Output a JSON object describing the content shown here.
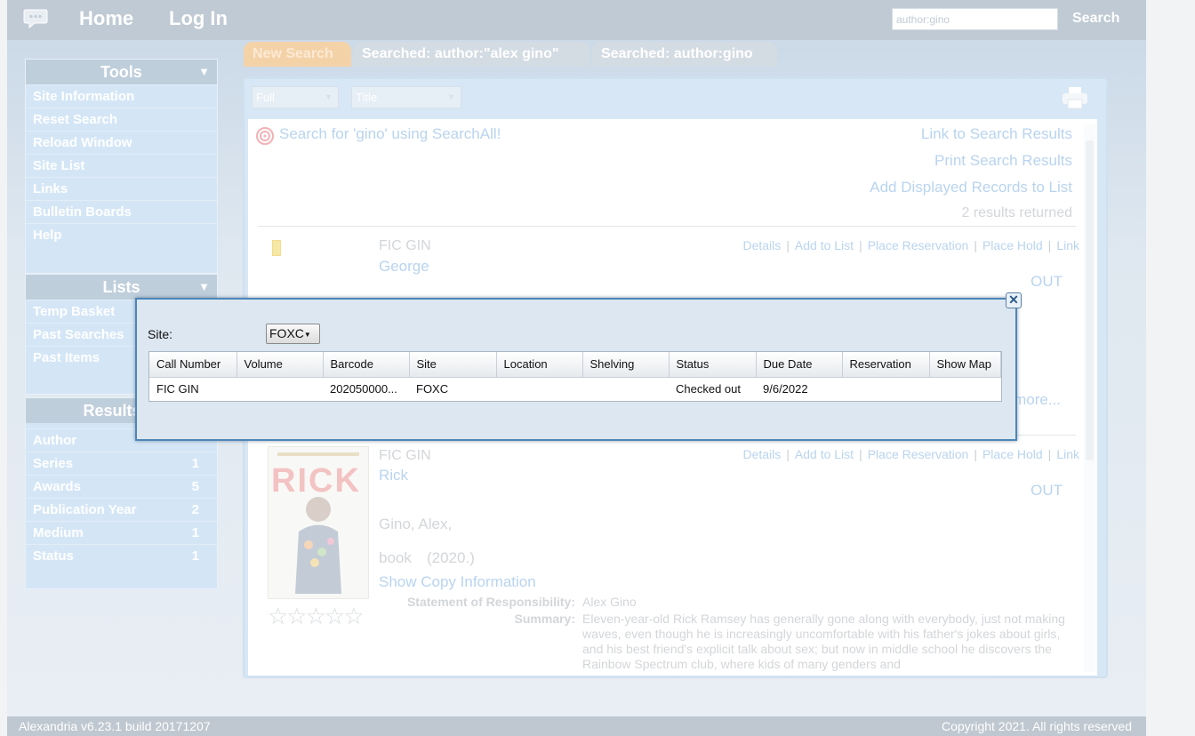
{
  "topbar": {
    "home": "Home",
    "login": "Log In",
    "search_value": "author:gino",
    "search_button": "Search"
  },
  "search_tabs": [
    "New Search",
    "Searched: author:\"alex gino\"",
    "Searched: author:gino"
  ],
  "sidebar": {
    "tools": {
      "title": "Tools",
      "items": [
        "Site Information",
        "Reset Search",
        "Reload Window",
        "Site List",
        "Links",
        "Bulletin Boards",
        "Help"
      ]
    },
    "lists": {
      "title": "Lists",
      "items": [
        "Temp Basket",
        "Past Searches",
        "Past Items"
      ]
    },
    "filters": {
      "title": "Results Fi",
      "items": [
        {
          "label": "Author",
          "count": ""
        },
        {
          "label": "Series",
          "count": "1"
        },
        {
          "label": "Awards",
          "count": "5"
        },
        {
          "label": "Publication Year",
          "count": "2"
        },
        {
          "label": "Medium",
          "count": "1"
        },
        {
          "label": "Status",
          "count": "1"
        }
      ]
    }
  },
  "results": {
    "view_select": "Full",
    "sort_select": "Title",
    "searchall": "Search for 'gino' using SearchAll!",
    "link_results": "Link to Search Results",
    "print_results": "Print Search Results",
    "add_records": "Add Displayed Records to List",
    "count": "2 results returned",
    "actions": [
      "Details",
      "Add to List",
      "Place Reservation",
      "Place Hold",
      "Link"
    ],
    "records": [
      {
        "call": "FIC GIN",
        "title": "George",
        "status": "OUT",
        "more": "more..."
      },
      {
        "call": "FIC GIN",
        "title": "Rick",
        "status": "OUT",
        "author": "Gino, Alex,",
        "medium": "book",
        "year": "(2020.)",
        "show_copy": "Show Copy Information",
        "sor_label": "Statement of Responsibility:",
        "sor_value": "Alex Gino",
        "summary_label": "Summary:",
        "summary": "Eleven-year-old Rick Ramsey has generally gone along with everybody, just not making waves, even though he is increasingly uncomfortable with his father's jokes about girls, and his best friend's explicit talk about sex; but now in middle school he discovers the Rainbow Spectrum club, where kids of many genders and"
      }
    ]
  },
  "dialog": {
    "site_label": "Site:",
    "site_value": "FOXC",
    "columns": [
      "Call Number",
      "Volume",
      "Barcode",
      "Site",
      "Location",
      "Shelving",
      "Status",
      "Due Date",
      "Reservation",
      "Show Map"
    ],
    "rows": [
      [
        "FIC GIN",
        "",
        "202050000...",
        "FOXC",
        "",
        "",
        "Checked out",
        "9/6/2022",
        "",
        ""
      ]
    ]
  },
  "footer": {
    "version": "Alexandria v6.23.1 build 20171207",
    "copyright": "Copyright 2021. All rights reserved"
  }
}
